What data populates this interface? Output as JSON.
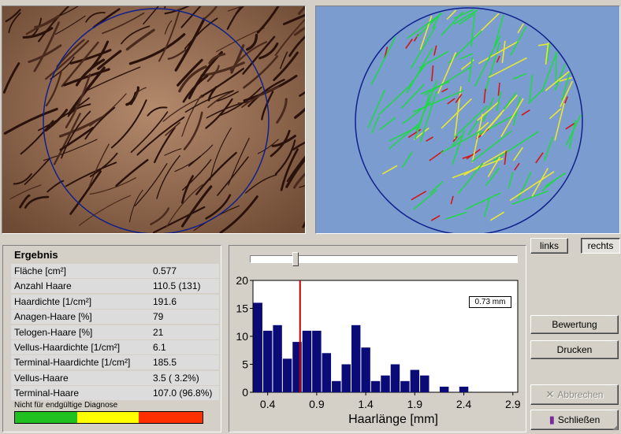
{
  "images": {
    "original": {
      "name": "scalp-dermoscopy-image"
    },
    "analysis": {
      "name": "hair-detection-overlay"
    }
  },
  "colors": {
    "circle": "#10208a",
    "overlay_bg": "#7b9ccf",
    "hair_green": "#22d64a",
    "hair_yellow": "#e8e830",
    "hair_red": "#d01818",
    "bar": "#0b0b78",
    "marker": "#c00000",
    "diag_green": "#1fc01f",
    "diag_yellow": "#ffff00",
    "diag_red": "#ff3000"
  },
  "side_buttons": {
    "links": "links",
    "rechts": "rechts",
    "selected": "rechts"
  },
  "result": {
    "title": "Ergebnis",
    "rows": [
      {
        "label": "Fläche [cm²]",
        "value": "0.577"
      },
      {
        "label": "Anzahl Haare",
        "value": "110.5 (131)"
      },
      {
        "label": "Haardichte [1/cm²]",
        "value": "191.6"
      },
      {
        "label": "Anagen-Haare [%]",
        "value": "79"
      },
      {
        "label": "Telogen-Haare [%]",
        "value": "21"
      },
      {
        "label": "Vellus-Haardichte [1/cm²]",
        "value": "6.1"
      },
      {
        "label": "Terminal-Haardichte [1/cm²]",
        "value": "185.5"
      },
      {
        "label": "Vellus-Haare",
        "value": "3.5 ( 3.2%)"
      },
      {
        "label": "Terminal-Haare",
        "value": "107.0 (96.8%)"
      }
    ],
    "diagnosis_note": "Nicht für endgültige Diagnose",
    "diagnosis_scale": [
      {
        "fraction": 0.33
      },
      {
        "fraction": 0.33
      },
      {
        "fraction": 0.34
      }
    ]
  },
  "histogram": {
    "slider_fraction": 0.17,
    "threshold_label": "0.73 mm"
  },
  "chart_data": {
    "type": "bar",
    "xlabel": "Haarlänge [mm]",
    "ylabel": "",
    "xlim": [
      0.25,
      2.95
    ],
    "ylim": [
      0,
      20
    ],
    "x_ticks": [
      0.4,
      0.9,
      1.4,
      1.9,
      2.4,
      2.9
    ],
    "x_tick_labels": [
      "0.4",
      "0.9",
      "1.4",
      "1.9",
      "2.4",
      "2.9"
    ],
    "y_ticks": [
      0,
      5,
      10,
      15,
      20
    ],
    "y_tick_labels": [
      "0",
      "5",
      "10",
      "15",
      "20"
    ],
    "bin_width": 0.1,
    "x": [
      0.3,
      0.4,
      0.5,
      0.6,
      0.7,
      0.8,
      0.9,
      1.0,
      1.1,
      1.2,
      1.3,
      1.4,
      1.5,
      1.6,
      1.7,
      1.8,
      1.9,
      2.0,
      2.1,
      2.2,
      2.3,
      2.4,
      2.5,
      2.6,
      2.7,
      2.8
    ],
    "values": [
      16,
      11,
      12,
      6,
      9,
      11,
      11,
      7,
      2,
      5,
      12,
      8,
      2,
      3,
      5,
      2,
      4,
      3,
      0,
      1,
      0,
      1,
      0,
      0,
      0,
      0
    ],
    "threshold": 0.73
  },
  "buttons": {
    "bewertung": "Bewertung",
    "drucken": "Drucken",
    "abbrechen": "Abbrechen",
    "schliessen": "Schließen"
  }
}
